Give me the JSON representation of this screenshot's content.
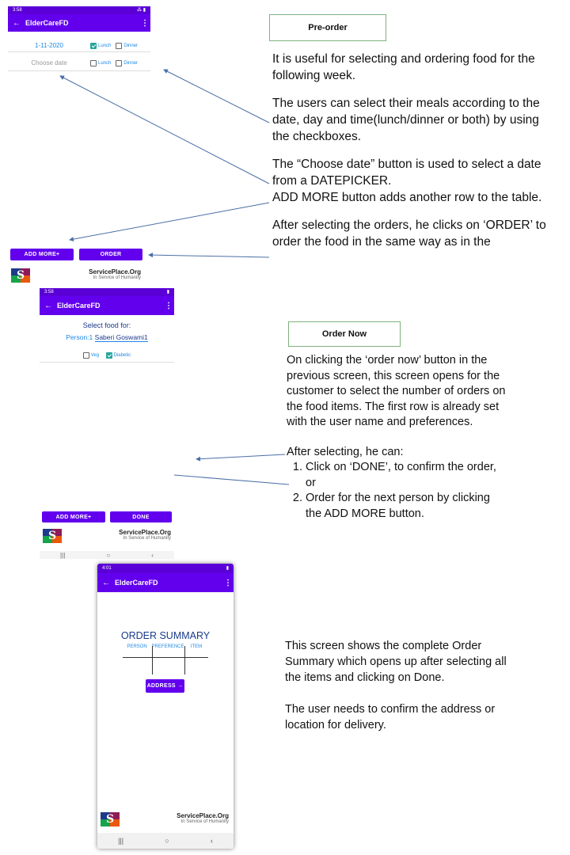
{
  "screen1": {
    "status_time": "3:58",
    "status_right": "⁂ ▮",
    "app_title": "ElderCareFD",
    "rows": [
      {
        "date": "1-11-2020",
        "lunch_checked": true,
        "dinner_checked": false
      },
      {
        "date": "Choose date",
        "lunch_checked": false,
        "dinner_checked": false
      }
    ],
    "lunch_label": "Lunch",
    "dinner_label": "Dinner",
    "add_more_label": "ADD MORE+",
    "order_label": "ORDER",
    "org_name": "ServicePlace.Org",
    "org_tagline": "In Service of Humanity"
  },
  "preorder": {
    "heading": "Pre-order",
    "paragraphs": [
      "It is useful for selecting and ordering food for the following week.",
      "The users can select their meals according to the date, day and time(lunch/dinner or both) by using the checkboxes.",
      "The “Choose date” button is used to select a date from a DATEPICKER.",
      "ADD MORE button adds another row to the table.",
      "After selecting the orders, he clicks on ‘ORDER’ to order the food in the same way as in the"
    ]
  },
  "screen2": {
    "status_time": "3:58",
    "app_title": "ElderCareFD",
    "select_label": "Select food for:",
    "person_label": "Person:1",
    "person_name": "Saberi Goswami1",
    "veg_label": "Veg",
    "diabetic_label": "Diabetic",
    "veg_checked": false,
    "diabetic_checked": true,
    "add_more_label": "ADD MORE+",
    "done_label": "DONE",
    "org_name": "ServicePlace.Org",
    "org_tagline": "In Service of Humanity",
    "nav_icons": [
      "|||",
      "○",
      "‹"
    ]
  },
  "ordernow": {
    "heading": "Order Now",
    "paragraph": "On clicking the ‘order now’ button in the previous screen, this screen opens for the customer to select the number of orders on the food items. The first row is already set with the user name and preferences.",
    "after": "After selecting, he can:",
    "items": [
      "Click on ‘DONE’, to confirm the order, or",
      "Order for the next person by clicking the ADD MORE button."
    ]
  },
  "screen3": {
    "status_time": "4:01",
    "app_title": "ElderCareFD",
    "summary_title": "ORDER SUMMARY",
    "columns": [
      "PERSON",
      "PREFERENCE",
      "ITEM"
    ],
    "address_label": "ADDRESS →",
    "org_name": "ServicePlace.Org",
    "org_tagline": "In Service of Humanity",
    "nav_icons": [
      "|||",
      "○",
      "‹"
    ]
  },
  "summary": {
    "paragraphs": [
      "This screen shows the complete Order Summary which opens up after selecting all the items and clicking on Done.",
      "The user needs to confirm the address or location for delivery."
    ]
  },
  "colors": {
    "primary": "#6200ee",
    "status": "#5a00d6",
    "link": "#1e88e5",
    "check": "#26a69a"
  }
}
